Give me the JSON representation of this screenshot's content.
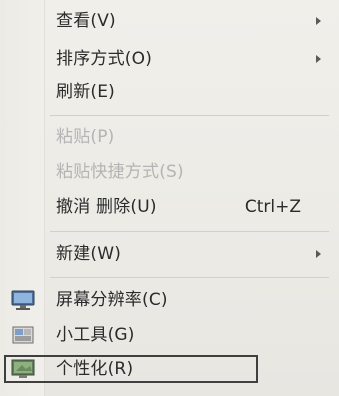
{
  "menu": {
    "items": [
      {
        "label": "查看(V)",
        "submenu": true,
        "enabled": true
      },
      {
        "label": "排序方式(O)",
        "submenu": true,
        "enabled": true
      },
      {
        "label": "刷新(E)",
        "submenu": false,
        "enabled": true
      },
      {
        "label": "粘贴(P)",
        "submenu": false,
        "enabled": false
      },
      {
        "label": "粘贴快捷方式(S)",
        "submenu": false,
        "enabled": false
      },
      {
        "label": "撤消 删除(U)",
        "shortcut": "Ctrl+Z",
        "submenu": false,
        "enabled": true
      },
      {
        "label": "新建(W)",
        "submenu": true,
        "enabled": true
      },
      {
        "label": "屏幕分辨率(C)",
        "icon": "monitor-icon",
        "submenu": false,
        "enabled": true
      },
      {
        "label": "小工具(G)",
        "icon": "gadgets-icon",
        "submenu": false,
        "enabled": true
      },
      {
        "label": "个性化(R)",
        "icon": "personalize-icon",
        "submenu": false,
        "enabled": true,
        "highlighted": true
      }
    ]
  }
}
